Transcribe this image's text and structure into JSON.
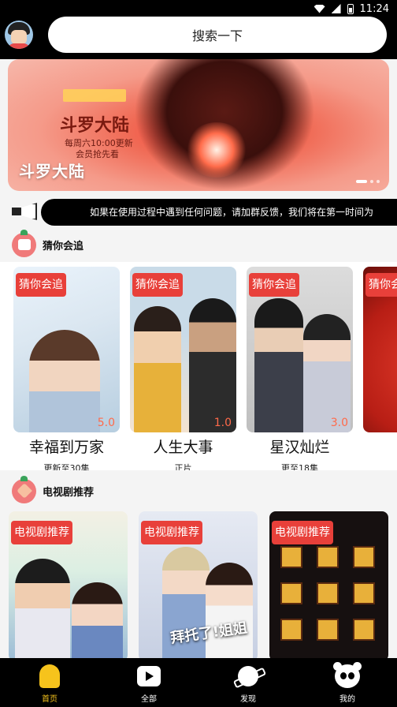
{
  "status_bar": {
    "time": "11:24"
  },
  "search": {
    "placeholder": "搜索一下"
  },
  "banner": {
    "title": "斗罗大陆",
    "logo_text": "斗罗大陆",
    "line1": "每周六10:00更新",
    "line2": "会员抢先看",
    "slides": 3,
    "active_slide": 1
  },
  "notice": {
    "text": "如果在使用过程中遇到任何问题，请加群反馈，我们将在第一时间为"
  },
  "sections": [
    {
      "title": "猜你会追",
      "items": [
        {
          "tag": "猜你会追",
          "title": "幸福到万家",
          "sub": "更新至30集",
          "score": "5.0"
        },
        {
          "tag": "猜你会追",
          "title": "人生大事",
          "sub": "正片",
          "score": "1.0"
        },
        {
          "tag": "猜你会追",
          "title": "星汉灿烂",
          "sub": "更至18集",
          "score": "3.0"
        },
        {
          "tag": "猜你会追",
          "title": "",
          "sub": "",
          "score": ""
        }
      ]
    },
    {
      "title": "电视剧推荐",
      "items": [
        {
          "tag": "电视剧推荐"
        },
        {
          "tag": "电视剧推荐",
          "poster_text": "拜托了!姐姐"
        },
        {
          "tag": "电视剧推荐"
        }
      ]
    }
  ],
  "bottom_nav": [
    {
      "label": "首页",
      "icon": "acorn-home-icon",
      "active": true
    },
    {
      "label": "全部",
      "icon": "play-icon",
      "active": false
    },
    {
      "label": "发现",
      "icon": "planet-icon",
      "active": false
    },
    {
      "label": "我的",
      "icon": "panda-icon",
      "active": false
    }
  ],
  "colors": {
    "accent": "#f6c31c",
    "tag": "#e8403a",
    "score": "#ff6a4a"
  }
}
